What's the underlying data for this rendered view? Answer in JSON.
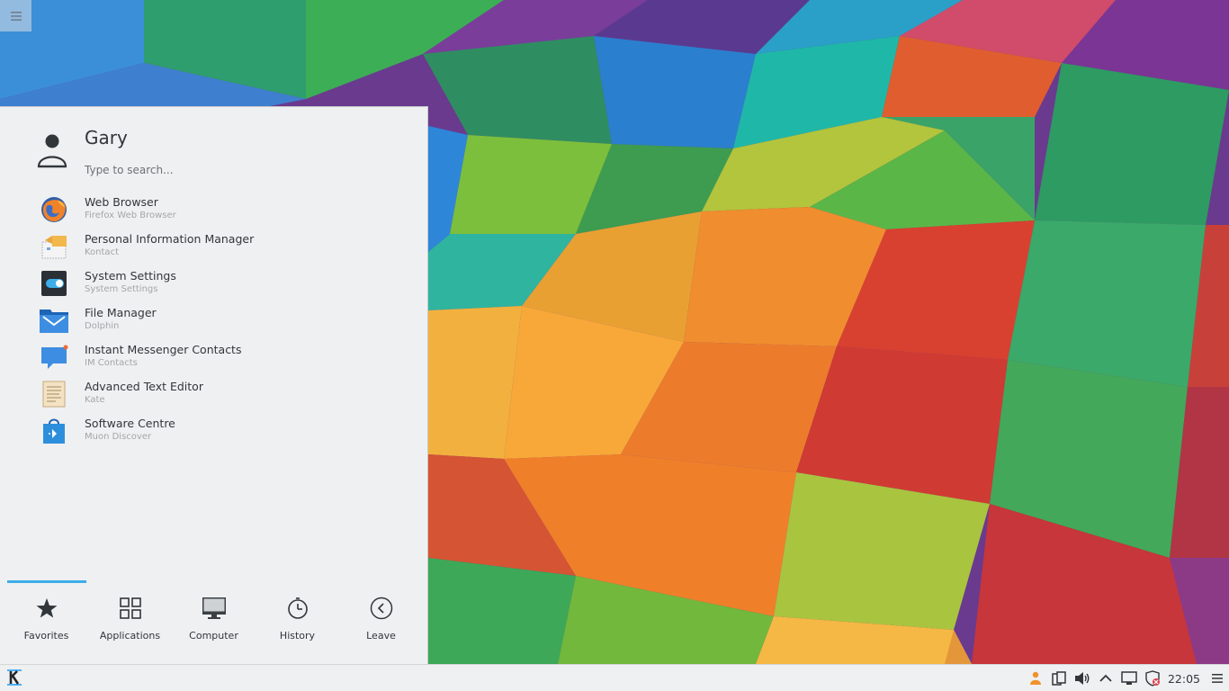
{
  "launcher": {
    "user_name": "Gary",
    "search_placeholder": "Type to search...",
    "favorites": [
      {
        "name": "Web Browser",
        "subtitle": "Firefox Web Browser",
        "icon": "firefox-icon"
      },
      {
        "name": "Personal Information Manager",
        "subtitle": "Kontact",
        "icon": "kontact-icon"
      },
      {
        "name": "System Settings",
        "subtitle": "System Settings",
        "icon": "system-settings-icon"
      },
      {
        "name": "File Manager",
        "subtitle": "Dolphin",
        "icon": "dolphin-icon"
      },
      {
        "name": "Instant Messenger Contacts",
        "subtitle": "IM Contacts",
        "icon": "im-contacts-icon"
      },
      {
        "name": "Advanced Text Editor",
        "subtitle": "Kate",
        "icon": "kate-icon"
      },
      {
        "name": "Software Centre",
        "subtitle": "Muon Discover",
        "icon": "muon-discover-icon"
      }
    ],
    "tabs": [
      {
        "label": "Favorites",
        "icon": "star-icon",
        "active": true
      },
      {
        "label": "Applications",
        "icon": "grid-icon",
        "active": false
      },
      {
        "label": "Computer",
        "icon": "monitor-icon",
        "active": false
      },
      {
        "label": "History",
        "icon": "history-icon",
        "active": false
      },
      {
        "label": "Leave",
        "icon": "leave-icon",
        "active": false
      }
    ]
  },
  "panel": {
    "clock": "22:05",
    "tray_icons": [
      "user-switcher-icon",
      "devices-icon",
      "volume-icon",
      "expand-tray-icon",
      "display-icon",
      "updates-icon"
    ]
  },
  "colors": {
    "accent": "#3daee9",
    "panel_bg": "#eff0f1",
    "text": "#31363b"
  }
}
